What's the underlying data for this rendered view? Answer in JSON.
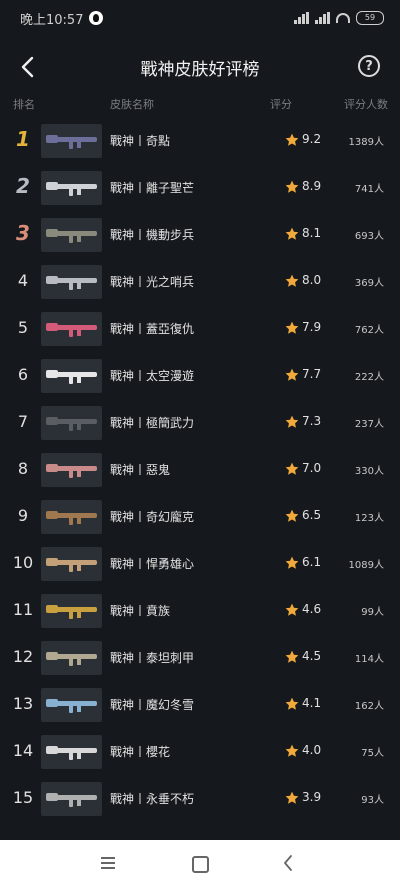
{
  "status_bar": {
    "time": "晚上10:57",
    "battery": "59"
  },
  "header": {
    "title": "戰神皮肤好评榜",
    "help_glyph": "?"
  },
  "columns": {
    "rank": "排名",
    "name": "皮肤名称",
    "score": "评分",
    "count": "评分人数"
  },
  "rows": [
    {
      "rank": "1",
      "name": "戰神丨奇點",
      "score": "9.2",
      "count": "1389人"
    },
    {
      "rank": "2",
      "name": "戰神丨離子聖芒",
      "score": "8.9",
      "count": "741人"
    },
    {
      "rank": "3",
      "name": "戰神丨機動步兵",
      "score": "8.1",
      "count": "693人"
    },
    {
      "rank": "4",
      "name": "戰神丨光之哨兵",
      "score": "8.0",
      "count": "369人"
    },
    {
      "rank": "5",
      "name": "戰神丨蓋亞復仇",
      "score": "7.9",
      "count": "762人"
    },
    {
      "rank": "6",
      "name": "戰神丨太空漫遊",
      "score": "7.7",
      "count": "222人"
    },
    {
      "rank": "7",
      "name": "戰神丨極簡武力",
      "score": "7.3",
      "count": "237人"
    },
    {
      "rank": "8",
      "name": "戰神丨惡鬼",
      "score": "7.0",
      "count": "330人"
    },
    {
      "rank": "9",
      "name": "戰神丨奇幻龐克",
      "score": "6.5",
      "count": "123人"
    },
    {
      "rank": "10",
      "name": "戰神丨悍勇雄心",
      "score": "6.1",
      "count": "1089人"
    },
    {
      "rank": "11",
      "name": "戰神丨賁族",
      "score": "4.6",
      "count": "99人"
    },
    {
      "rank": "12",
      "name": "戰神丨泰坦刺甲",
      "score": "4.5",
      "count": "114人"
    },
    {
      "rank": "13",
      "name": "戰神丨魔幻冬雪",
      "score": "4.1",
      "count": "162人"
    },
    {
      "rank": "14",
      "name": "戰神丨櫻花",
      "score": "4.0",
      "count": "75人"
    },
    {
      "rank": "15",
      "name": "戰神丨永垂不朽",
      "score": "3.9",
      "count": "93人"
    }
  ],
  "thumb_colors": [
    "#6e6e9a",
    "#cfd2d6",
    "#8a8a7c",
    "#b8bcc2",
    "#d45a7a",
    "#e6e6e6",
    "#5a5e63",
    "#c98a8a",
    "#a07850",
    "#c4a078",
    "#c8a040",
    "#b0a890",
    "#88b0d0",
    "#d8d8d8",
    "#b0b0b0"
  ],
  "colors": {
    "star": "#f2a93b",
    "gold": "#e3b43a",
    "silver": "#b7bcc4",
    "bronze": "#d98e7a"
  }
}
